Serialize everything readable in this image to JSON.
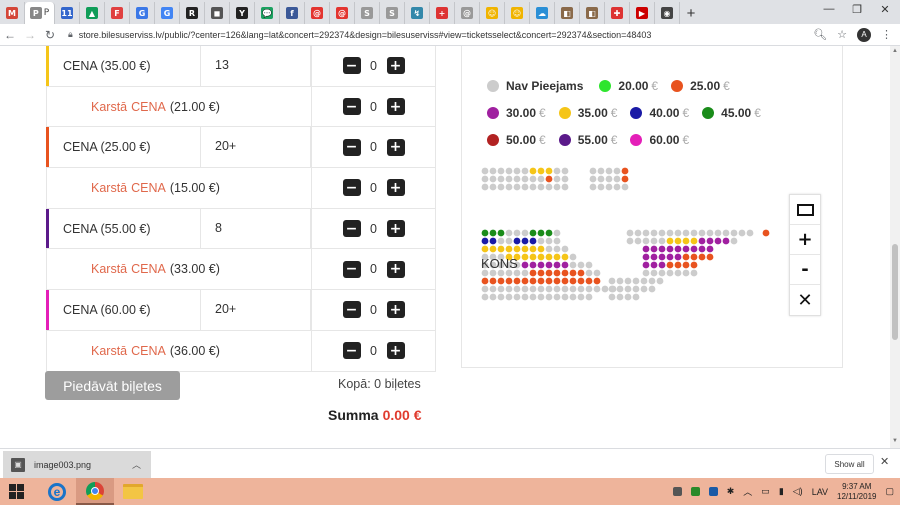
{
  "browser": {
    "tabs": [
      {
        "fav": "M",
        "color": "#d44638",
        "icon": "gmail-icon"
      },
      {
        "fav": "P",
        "color": "#888888",
        "icon": "page-icon",
        "active": true
      },
      {
        "fav": "11",
        "color": "#3366cc",
        "icon": "calendar-icon"
      },
      {
        "fav": "▲",
        "color": "#0f9d58",
        "icon": "drive-icon"
      },
      {
        "fav": "F",
        "color": "#e04040",
        "icon": "flag-icon"
      },
      {
        "fav": "G",
        "color": "#3b78e7",
        "icon": "translate-icon"
      },
      {
        "fav": "G",
        "color": "#4285f4",
        "icon": "google-icon"
      },
      {
        "fav": "R",
        "color": "#222222",
        "icon": "reader-icon"
      },
      {
        "fav": "◼",
        "color": "#555555",
        "icon": "page-icon"
      },
      {
        "fav": "Y",
        "color": "#222222",
        "icon": "site-icon"
      },
      {
        "fav": "💬",
        "color": "#1ba160",
        "icon": "chat-icon"
      },
      {
        "fav": "f",
        "color": "#3b5998",
        "icon": "facebook-icon"
      },
      {
        "fav": "@",
        "color": "#e3342f",
        "icon": "mail-icon"
      },
      {
        "fav": "@",
        "color": "#e3342f",
        "icon": "mail-icon"
      },
      {
        "fav": "S",
        "color": "#999999",
        "icon": "site-icon"
      },
      {
        "fav": "S",
        "color": "#999999",
        "icon": "site-icon"
      },
      {
        "fav": "↯",
        "color": "#38a",
        "icon": "site-icon"
      },
      {
        "fav": "+",
        "color": "#d33",
        "icon": "medical-icon"
      },
      {
        "fav": "@",
        "color": "#999999",
        "icon": "mail-icon"
      },
      {
        "fav": "☺",
        "color": "#f0b400",
        "icon": "emoji-icon"
      },
      {
        "fav": "☺",
        "color": "#f0b400",
        "icon": "emoji-icon"
      },
      {
        "fav": "☁",
        "color": "#2a8fd6",
        "icon": "weather-icon"
      },
      {
        "fav": "◧",
        "color": "#8a6a4a",
        "icon": "site-icon"
      },
      {
        "fav": "◧",
        "color": "#8a6a4a",
        "icon": "site-icon"
      },
      {
        "fav": "✚",
        "color": "#d33",
        "icon": "site-icon"
      },
      {
        "fav": "▶",
        "color": "#c00",
        "icon": "video-icon"
      },
      {
        "fav": "◉",
        "color": "#444",
        "icon": "site-icon"
      }
    ],
    "active_tab_label": "P",
    "url": "store.bilesuserviss.lv/public/?center=126&lang=lat&concert=292374&design=bilesuserviss#view=ticketsselect&concert=292374&section=48403",
    "avatar_letter": "A"
  },
  "prices": [
    {
      "name": "CENA (35.00 €)",
      "available": "13",
      "qty": "0",
      "accent": "#f5c518",
      "hot_label": "Karstā",
      "hot_name": "CENA (21.00 €)",
      "hot_qty": "0"
    },
    {
      "name": "CENA (25.00 €)",
      "available": "20+",
      "qty": "0",
      "accent": "#e8531f",
      "hot_label": "Karstā",
      "hot_name": "CENA (15.00 €)",
      "hot_qty": "0"
    },
    {
      "name": "CENA (55.00 €)",
      "available": "8",
      "qty": "0",
      "accent": "#5b1a8a",
      "hot_label": "Karstā",
      "hot_name": "CENA (33.00 €)",
      "hot_qty": "0"
    },
    {
      "name": "CENA (60.00 €)",
      "available": "20+",
      "qty": "0",
      "accent": "#e41fb8",
      "hot_label": "Karstā",
      "hot_name": "CENA (36.00 €)",
      "hot_qty": "0"
    }
  ],
  "qty_minus": "−",
  "qty_plus": "+",
  "offer_button": "Piedāvāt biļetes",
  "total_label": "Kopā: 0 biļetes",
  "sum_label": "Summa",
  "sum_value": "0.00 €",
  "legend": [
    [
      {
        "label": "Nav Pieejams",
        "color": "#cccccc",
        "eur": ""
      },
      {
        "label": "20.00",
        "color": "#2ee52e",
        "eur": "€"
      },
      {
        "label": "25.00",
        "color": "#e8531f",
        "eur": "€"
      }
    ],
    [
      {
        "label": "30.00",
        "color": "#a020a0",
        "eur": "€"
      },
      {
        "label": "35.00",
        "color": "#f5c518",
        "eur": "€"
      },
      {
        "label": "40.00",
        "color": "#1a1aa6",
        "eur": "€"
      },
      {
        "label": "45.00",
        "color": "#1a8c1a",
        "eur": "€"
      }
    ],
    [
      {
        "label": "50.00",
        "color": "#b22222",
        "eur": "€"
      },
      {
        "label": "55.00",
        "color": "#5b1a8a",
        "eur": "€"
      },
      {
        "label": "60.00",
        "color": "#e41fb8",
        "eur": "€"
      }
    ]
  ],
  "section_label": "KONS",
  "zoom": {
    "reset": "fit-view-icon",
    "in": "+",
    "out": "-",
    "close": "✕"
  },
  "downloads": {
    "file": "image003.png",
    "show_all": "Show all",
    "close": "✕"
  },
  "taskbar": {
    "lang": "LAV",
    "time": "9:37 AM",
    "date": "12/11/2019"
  }
}
